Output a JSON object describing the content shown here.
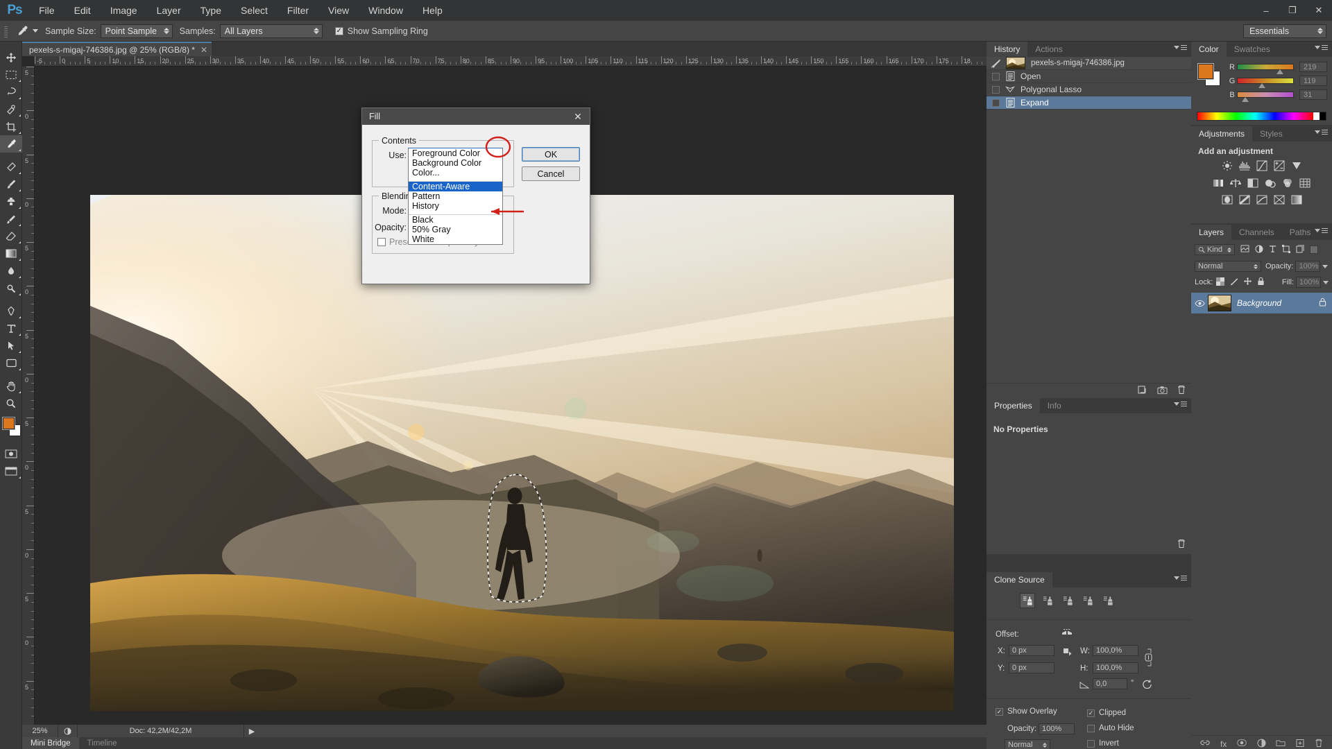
{
  "app": {
    "logo": "Ps",
    "workspace": "Essentials"
  },
  "menubar": {
    "items": [
      "File",
      "Edit",
      "Image",
      "Layer",
      "Type",
      "Select",
      "Filter",
      "View",
      "Window",
      "Help"
    ]
  },
  "window_controls": {
    "minimize": "–",
    "maximize": "❐",
    "close": "✕"
  },
  "options_bar": {
    "tool_icon": "eyedropper-icon",
    "sample_size_label": "Sample Size:",
    "sample_size_value": "Point Sample",
    "sample_label": "Samples:",
    "sample_value": "All Layers",
    "show_ring_label": "Show Sampling Ring",
    "show_ring_checked": true
  },
  "document_tab": {
    "title": "pexels-s-migaj-746386.jpg @ 25% (RGB/8) *",
    "close": "✕"
  },
  "rulers": {
    "h_ticks": [
      "-5",
      "0",
      "5",
      "10",
      "15",
      "20",
      "25",
      "30",
      "35",
      "40",
      "45",
      "50",
      "55",
      "60",
      "65",
      "70",
      "75",
      "80",
      "85",
      "90",
      "95",
      "100",
      "105",
      "110",
      "115",
      "120",
      "125",
      "130",
      "135",
      "140",
      "145",
      "150",
      "155",
      "160",
      "165",
      "170",
      "175",
      "18"
    ],
    "v_ticks": [
      "5",
      "0",
      "5",
      "0",
      "5",
      "0",
      "5",
      "0",
      "5",
      "0",
      "5",
      "0",
      "5",
      "0",
      "5"
    ]
  },
  "status_bar": {
    "zoom": "25%",
    "doc_info": "Doc: 42,2M/42,2M",
    "play_arrow": "▶"
  },
  "bottom_tabs": [
    {
      "label": "Mini Bridge",
      "active": true
    },
    {
      "label": "Timeline",
      "active": false
    }
  ],
  "toolbar": {
    "tools": [
      "move-tool",
      "marquee-tool",
      "lasso-tool",
      "quick-select-tool",
      "crop-tool",
      "eyedropper-tool",
      "spot-healing-tool",
      "brush-tool",
      "clone-stamp-tool",
      "history-brush-tool",
      "eraser-tool",
      "gradient-tool",
      "blur-tool",
      "dodge-tool",
      "pen-tool",
      "type-tool",
      "path-select-tool",
      "shape-tool",
      "hand-tool",
      "zoom-tool"
    ],
    "foreground_color": "#db771f",
    "background_color": "#ffffff"
  },
  "fill_dialog": {
    "title": "Fill",
    "close": "✕",
    "contents_group": "Contents",
    "use_label": "Use:",
    "use_value": "Content-Aware",
    "blending_group": "Blending",
    "mode_label": "Mode:",
    "opacity_label": "Opacity:",
    "preserve_label": "Preserve Transparency",
    "ok_label": "OK",
    "cancel_label": "Cancel",
    "dropdown_options": [
      {
        "label": "Foreground Color",
        "selected": false
      },
      {
        "label": "Background Color",
        "selected": false
      },
      {
        "label": "Color...",
        "selected": false
      },
      {
        "label": "Content-Aware",
        "selected": true
      },
      {
        "label": "Pattern",
        "selected": false
      },
      {
        "label": "History",
        "selected": false
      },
      {
        "label": "Black",
        "selected": false
      },
      {
        "label": "50% Gray",
        "selected": false
      },
      {
        "label": "White",
        "selected": false
      }
    ],
    "annotation_color": "#d0221b"
  },
  "history_panel": {
    "tabs": [
      {
        "label": "History",
        "active": true
      },
      {
        "label": "Actions",
        "active": false
      }
    ],
    "snapshot": "pexels-s-migaj-746386.jpg",
    "states": [
      {
        "label": "Open",
        "icon": "document-icon",
        "selected": false
      },
      {
        "label": "Polygonal Lasso",
        "icon": "polygonal-lasso-icon",
        "selected": false
      },
      {
        "label": "Expand",
        "icon": "document-icon",
        "selected": true
      }
    ],
    "footer_icons": [
      "create-document-icon",
      "create-snapshot-icon",
      "delete-icon"
    ]
  },
  "properties_panel": {
    "tabs": [
      {
        "label": "Properties",
        "active": true
      },
      {
        "label": "Info",
        "active": false
      }
    ],
    "empty_message": "No Properties",
    "footer_icons": [
      "delete-icon"
    ]
  },
  "clone_source_panel": {
    "tab": "Clone Source",
    "sources": [
      "clone-source-1",
      "clone-source-2",
      "clone-source-3",
      "clone-source-4",
      "clone-source-5"
    ],
    "offset_label": "Offset:",
    "x_label": "X:",
    "x_value": "0 px",
    "y_label": "Y:",
    "y_value": "0 px",
    "w_label": "W:",
    "w_value": "100,0%",
    "h_label": "H:",
    "h_value": "100,0%",
    "angle_value": "0,0",
    "angle_unit": "°",
    "link_icon": "link-icon",
    "reset_icon": "reset-icon",
    "flip_h_icon": "flip-horizontal-icon",
    "flip_v_icon": "flip-vertical-icon",
    "show_overlay_label": "Show Overlay",
    "show_overlay_checked": true,
    "opacity_label": "Opacity:",
    "opacity_value": "100%",
    "blend_value": "Normal",
    "clipped_label": "Clipped",
    "clipped_checked": true,
    "auto_hide_label": "Auto Hide",
    "auto_hide_checked": false,
    "invert_label": "Invert",
    "invert_checked": false
  },
  "color_panel": {
    "tabs": [
      {
        "label": "Color",
        "active": true
      },
      {
        "label": "Swatches",
        "active": false
      }
    ],
    "foreground": "#db771f",
    "background": "#ffffff",
    "channels": [
      {
        "label": "R",
        "value": "219"
      },
      {
        "label": "G",
        "value": "119"
      },
      {
        "label": "B",
        "value": "31"
      }
    ]
  },
  "adjustments_panel": {
    "tabs": [
      {
        "label": "Adjustments",
        "active": true
      },
      {
        "label": "Styles",
        "active": false
      }
    ],
    "heading": "Add an adjustment",
    "icons": [
      "brightness-contrast-icon",
      "levels-icon",
      "curves-icon",
      "exposure-icon",
      "vibrance-icon",
      "hue-saturation-icon",
      "color-balance-icon",
      "black-white-icon",
      "photo-filter-icon",
      "channel-mixer-icon",
      "color-lookup-icon",
      "invert-icon",
      "posterize-icon",
      "threshold-icon",
      "selective-color-icon",
      "gradient-map-icon"
    ]
  },
  "layers_panel": {
    "tabs": [
      {
        "label": "Layers",
        "active": true
      },
      {
        "label": "Channels",
        "active": false
      },
      {
        "label": "Paths",
        "active": false
      }
    ],
    "filter_label": "Kind",
    "filter_icons": [
      "pixel-filter-icon",
      "adjustment-filter-icon",
      "type-filter-icon",
      "shape-filter-icon",
      "smart-object-filter-icon"
    ],
    "blend_mode": "Normal",
    "opacity_label": "Opacity:",
    "opacity_value": "100%",
    "lock_label": "Lock:",
    "lock_icons": [
      "lock-transparent-icon",
      "lock-image-icon",
      "lock-position-icon",
      "lock-all-icon"
    ],
    "fill_label": "Fill:",
    "fill_value": "100%",
    "layers": [
      {
        "name": "Background",
        "locked": true,
        "visible": true,
        "selected": true
      }
    ],
    "footer_icons": [
      "link-layers-icon",
      "layer-style-icon",
      "layer-mask-icon",
      "adjustment-layer-icon",
      "new-group-icon",
      "new-layer-icon",
      "delete-layer-icon"
    ]
  }
}
